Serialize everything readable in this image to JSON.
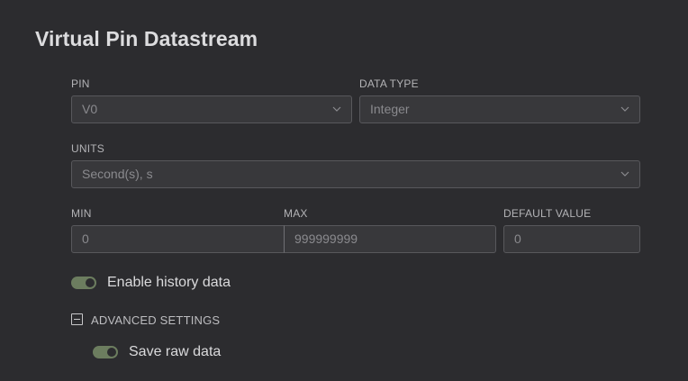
{
  "header": {
    "title": "Virtual Pin Datastream"
  },
  "form": {
    "pin": {
      "label": "PIN",
      "value": "V0",
      "icon": "chevron-down-icon"
    },
    "data_type": {
      "label": "DATA TYPE",
      "value": "Integer",
      "icon": "chevron-down-icon"
    },
    "units": {
      "label": "UNITS",
      "placeholder": "Second(s), s",
      "icon": "chevron-down-icon"
    },
    "min": {
      "label": "MIN",
      "placeholder": "0"
    },
    "max": {
      "label": "MAX",
      "placeholder": "999999999"
    },
    "default_value": {
      "label": "DEFAULT VALUE",
      "placeholder": "0"
    },
    "enable_history": {
      "label": "Enable history data",
      "checked": true
    },
    "advanced": {
      "label": "ADVANCED SETTINGS",
      "expanded": true,
      "icon": "collapse-icon"
    },
    "save_raw": {
      "label": "Save raw data",
      "checked": true
    }
  },
  "colors": {
    "background": "#2c2c2f",
    "field_background": "#38383b",
    "field_border": "#58585c",
    "toggle_on": "#6c7d5f"
  }
}
